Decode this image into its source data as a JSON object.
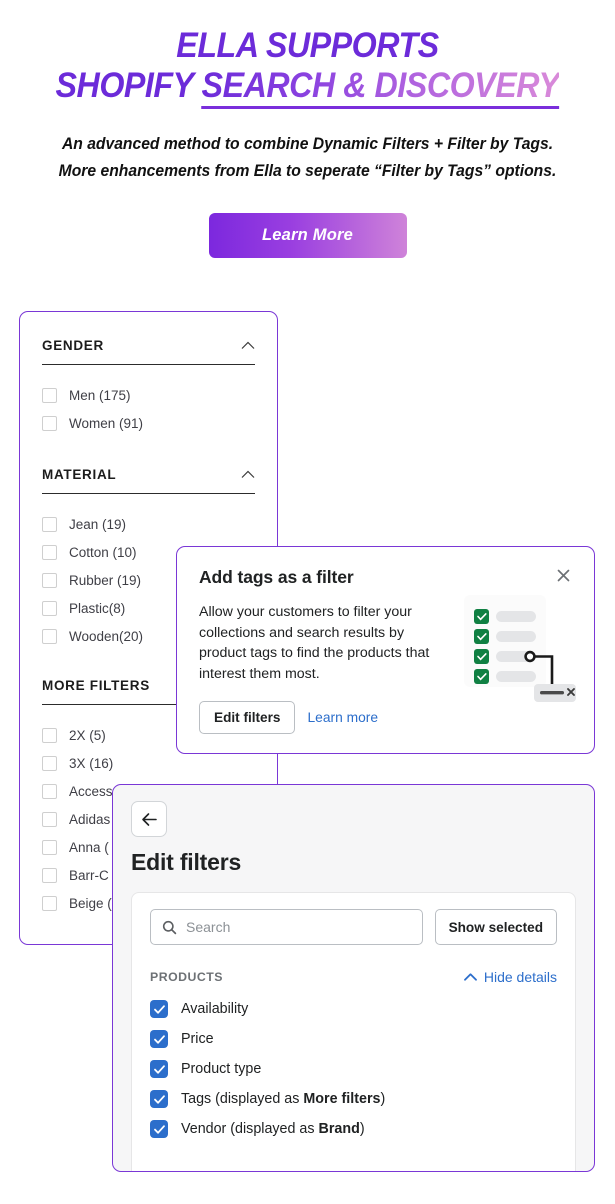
{
  "hero": {
    "title_line1": "ELLA SUPPORTS",
    "title_line2_solid": "SHOPIFY ",
    "title_line2_gradient": "SEARCH & DISCOVERY",
    "subtitle_line1": "An advanced method to combine Dynamic Filters + Filter by Tags.",
    "subtitle_line2": "More enhancements from Ella to seperate “Filter by Tags” options.",
    "cta_label": "Learn More",
    "colors": {
      "purple": "#6c2bd9",
      "pink": "#d98ad9",
      "button_gradient_start": "#7c28de",
      "button_gradient_end": "#cf83d9"
    }
  },
  "filter_panel": {
    "border_color": "#7a37d6",
    "groups": [
      {
        "title": "GENDER",
        "collapse_icon": "chevron-up-icon",
        "options": [
          {
            "label": "Men (175)",
            "checked": false
          },
          {
            "label": "Women (91)",
            "checked": false
          }
        ]
      },
      {
        "title": "MATERIAL",
        "collapse_icon": "chevron-up-icon",
        "options": [
          {
            "label": "Jean (19)",
            "checked": false
          },
          {
            "label": "Cotton (10)",
            "checked": false
          },
          {
            "label": "Rubber (19)",
            "checked": false
          },
          {
            "label": "Plastic(8)",
            "checked": false
          },
          {
            "label": "Wooden(20)",
            "checked": false
          }
        ]
      },
      {
        "title": "MORE FILTERS",
        "collapse_icon": "chevron-up-icon",
        "options": [
          {
            "label": "2X (5)",
            "checked": false
          },
          {
            "label": "3X (16)",
            "checked": false
          },
          {
            "label": "Access",
            "checked": false
          },
          {
            "label": "Adidas",
            "checked": false
          },
          {
            "label": "Anna (",
            "checked": false
          },
          {
            "label": "Barr-C",
            "checked": false
          },
          {
            "label": "Beige (",
            "checked": false
          }
        ]
      }
    ]
  },
  "tags_card": {
    "title": "Add tags as a filter",
    "close_icon": "close-icon",
    "body": "Allow your customers to filter your collections and search results by product tags to find the products that interest them most.",
    "edit_button": "Edit filters",
    "learn_link": "Learn more",
    "illustration": {
      "name": "tag-filter-illustration",
      "checkbox_color": "#108043",
      "rows": 4
    }
  },
  "edit_panel": {
    "back_icon": "arrow-left-icon",
    "title": "Edit filters",
    "search": {
      "placeholder": "Search",
      "value": "",
      "icon": "search-icon"
    },
    "show_selected_button": "Show selected",
    "section_label": "PRODUCTS",
    "hide_details": {
      "label": "Hide details",
      "icon": "chevron-up-icon",
      "color": "#2c6ecb"
    },
    "checkbox_color": "#2c6ecb",
    "items": [
      {
        "text": "Availability",
        "bold": "",
        "suffix": "",
        "checked": true
      },
      {
        "text": "Price",
        "bold": "",
        "suffix": "",
        "checked": true
      },
      {
        "text": "Product type",
        "bold": "",
        "suffix": "",
        "checked": true
      },
      {
        "text": "Tags (displayed as ",
        "bold": "More filters",
        "suffix": ")",
        "checked": true
      },
      {
        "text": "Vendor (displayed as ",
        "bold": "Brand",
        "suffix": ")",
        "checked": true
      }
    ]
  }
}
